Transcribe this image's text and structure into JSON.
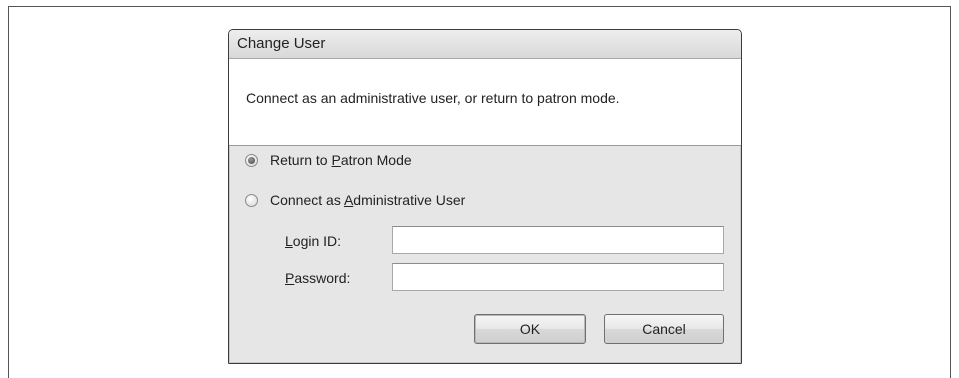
{
  "dialog": {
    "title": "Change User",
    "instruction": "Connect as an administrative user, or return to patron mode.",
    "options": [
      {
        "pre": "Return to ",
        "mnemonic": "P",
        "post": "atron Mode",
        "checked": true
      },
      {
        "pre": "Connect as ",
        "mnemonic": "A",
        "post": "dministrative User",
        "checked": false
      }
    ],
    "login": {
      "mnemonic": "L",
      "rest": "ogin ID:",
      "value": "",
      "placeholder": ""
    },
    "password": {
      "mnemonic": "P",
      "rest": "assword:",
      "value": "",
      "placeholder": ""
    },
    "ok_label": "OK",
    "cancel_label": "Cancel"
  }
}
